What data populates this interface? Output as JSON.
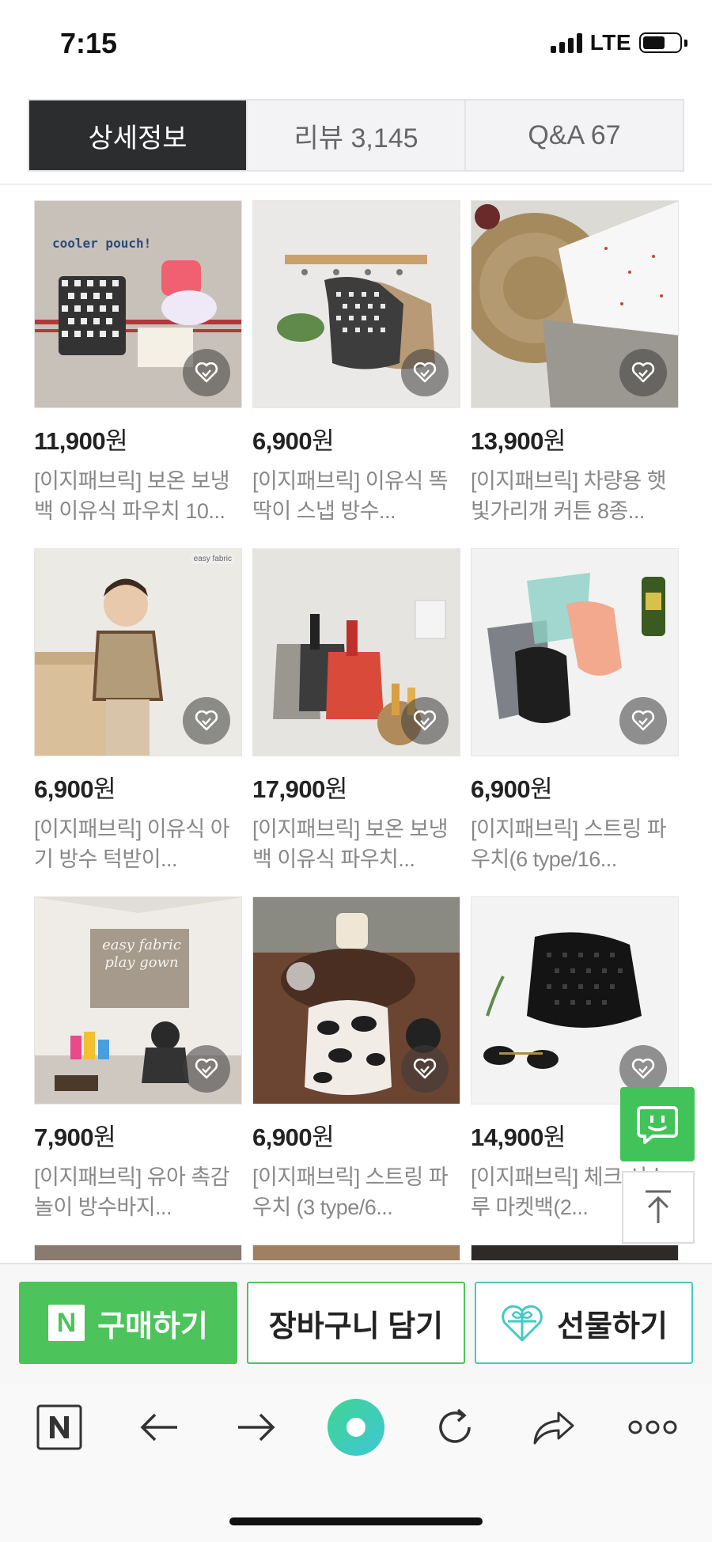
{
  "status": {
    "time": "7:15",
    "network": "LTE"
  },
  "tabs": [
    {
      "label": "상세정보",
      "active": true
    },
    {
      "label": "리뷰  3,145",
      "active": false
    },
    {
      "label": "Q&A  67",
      "active": false
    }
  ],
  "products": [
    {
      "price": "11,900",
      "currency": "원",
      "name": "[이지패브릭] 보온 보냉백 이유식 파우치 10...",
      "thumb_text": "cooler pouch!",
      "colors": [
        "#c9c3bb",
        "#b03a3a"
      ]
    },
    {
      "price": "6,900",
      "currency": "원",
      "name": "[이지패브릭] 이유식 똑딱이 스냅 방수...",
      "thumb_text": "",
      "colors": [
        "#e9e8e6",
        "#3a3a3a"
      ]
    },
    {
      "price": "13,900",
      "currency": "원",
      "name": "[이지패브릭] 차량용 햇빛가리개 커튼 8종...",
      "thumb_text": "",
      "colors": [
        "#d9d7d2",
        "#a58a5e"
      ]
    },
    {
      "price": "6,900",
      "currency": "원",
      "name": "[이지패브릭] 이유식 아기 방수 턱받이...",
      "thumb_text": "easy fabric",
      "colors": [
        "#ece9e4",
        "#b29c7a"
      ]
    },
    {
      "price": "17,900",
      "currency": "원",
      "name": "[이지패브릭] 보온 보냉백 이유식 파우치...",
      "thumb_text": "",
      "colors": [
        "#e6e4e0",
        "#d94a3a"
      ]
    },
    {
      "price": "6,900",
      "currency": "원",
      "name": "[이지패브릭] 스트링 파우치(6 type/16...",
      "thumb_text": "",
      "colors": [
        "#f1f1f1",
        "#8ccfc4"
      ]
    },
    {
      "price": "7,900",
      "currency": "원",
      "name": "[이지패브릭] 유아 촉감놀이 방수바지...",
      "thumb_text": "easy fabric play gown",
      "colors": [
        "#d8d2cb",
        "#8a7a6a"
      ]
    },
    {
      "price": "6,900",
      "currency": "원",
      "name": "[이지패브릭] 스트링 파우치 (3 type/6...",
      "thumb_text": "",
      "colors": [
        "#6b4432",
        "#1e1e1e"
      ]
    },
    {
      "price": "14,900",
      "currency": "원",
      "name": "[이지패브릭] 체크 시스루 마켓백(2...",
      "thumb_text": "",
      "colors": [
        "#f2f2f2",
        "#111111"
      ]
    }
  ],
  "buttons": {
    "buy": "구매하기",
    "buy_logo": "N",
    "cart": "장바구니 담기",
    "gift": "선물하기"
  },
  "colors": {
    "naver_green": "#4cc35b",
    "gift_teal": "#46c9c0",
    "tab_active": "#2b2d2e"
  },
  "icons": {
    "wish": "heart-icon",
    "chat": "chat-icon",
    "top": "arrow-up-icon",
    "nav": [
      "naver-home-icon",
      "back-arrow-icon",
      "forward-arrow-icon",
      "green-dot-icon",
      "refresh-icon",
      "share-icon",
      "more-icon"
    ]
  }
}
